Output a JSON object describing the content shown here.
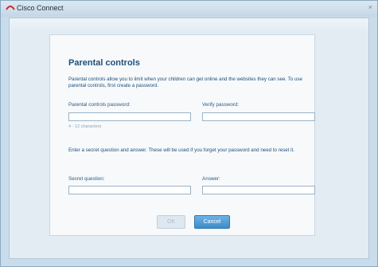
{
  "window": {
    "title": "Cisco Connect"
  },
  "dialog": {
    "heading": "Parental controls",
    "description": "Parental controls allow you to limit when your children can get online and the websites they can see. To use parental controls, first create a password.",
    "password_label": "Parental controls password:",
    "password_value": "",
    "password_hint": "4 - 12 characters",
    "verify_label": "Verify password:",
    "verify_value": "",
    "secret_instructions": "Enter a secret question and answer. These will be used if you forget your password and need to reset it.",
    "question_label": "Secret question:",
    "question_value": "",
    "answer_label": "Answer:",
    "answer_value": "",
    "ok_label": "OK",
    "cancel_label": "Cancel"
  },
  "colors": {
    "accent": "#3c8cc8",
    "heading": "#1f4f7a"
  }
}
